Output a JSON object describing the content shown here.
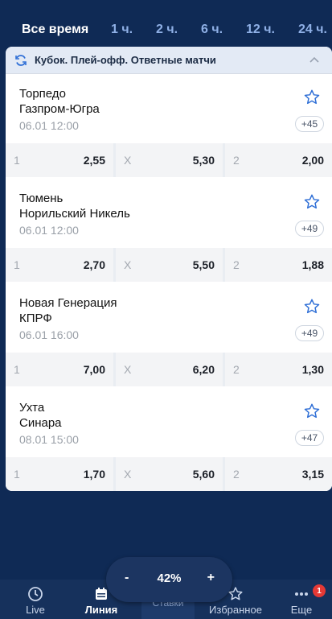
{
  "filters": [
    {
      "label": "Все время"
    },
    {
      "label": "1 ч."
    },
    {
      "label": "2 ч."
    },
    {
      "label": "6 ч."
    },
    {
      "label": "12 ч."
    },
    {
      "label": "24 ч."
    }
  ],
  "league": {
    "title": "Кубок. Плей-офф. Ответные матчи",
    "icon": "refresh-icon",
    "collapse_icon": "chevron-up-icon"
  },
  "matches": [
    {
      "team1": "Торпедо",
      "team2": "Газпром-Югра",
      "time": "06.01 12:00",
      "more": "+45",
      "odds": [
        {
          "label": "1",
          "value": "2,55"
        },
        {
          "label": "X",
          "value": "5,30"
        },
        {
          "label": "2",
          "value": "2,00"
        }
      ]
    },
    {
      "team1": "Тюмень",
      "team2": "Норильский Никель",
      "time": "06.01 12:00",
      "more": "+49",
      "odds": [
        {
          "label": "1",
          "value": "2,70"
        },
        {
          "label": "X",
          "value": "5,50"
        },
        {
          "label": "2",
          "value": "1,88"
        }
      ]
    },
    {
      "team1": "Новая Генерация",
      "team2": "КПРФ",
      "time": "06.01 16:00",
      "more": "+49",
      "odds": [
        {
          "label": "1",
          "value": "7,00"
        },
        {
          "label": "X",
          "value": "6,20"
        },
        {
          "label": "2",
          "value": "1,30"
        }
      ]
    },
    {
      "team1": "Ухта",
      "team2": "Синара",
      "time": "08.01 15:00",
      "more": "+47",
      "odds": [
        {
          "label": "1",
          "value": "1,70"
        },
        {
          "label": "X",
          "value": "5,60"
        },
        {
          "label": "2",
          "value": "3,15"
        }
      ]
    }
  ],
  "zoom": {
    "minus": "-",
    "value": "42%",
    "plus": "+"
  },
  "tabbar": {
    "live": "Live",
    "line": "Линия",
    "bets": "Ставки",
    "favorites": "Избранное",
    "more": "Еще",
    "more_badge": "1"
  },
  "colors": {
    "background": "#0f2a55",
    "accent": "#2f6fd6",
    "badge": "#e53935"
  }
}
